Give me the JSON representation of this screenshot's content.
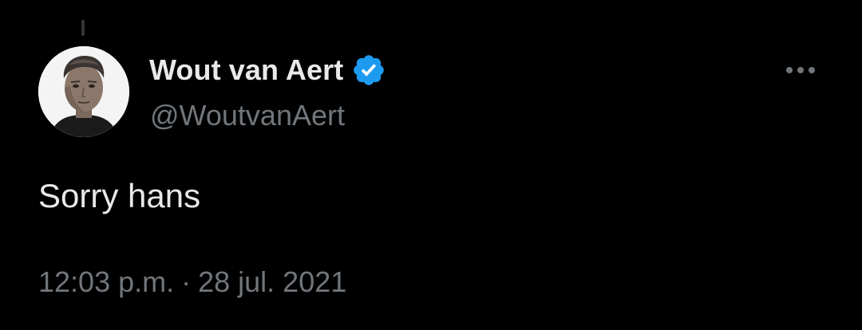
{
  "author": {
    "display_name": "Wout van Aert",
    "handle": "@WoutvanAert",
    "verified": true
  },
  "tweet": {
    "text": "Sorry hans",
    "time": "12:03 p.m.",
    "separator": "·",
    "date": "28 jul. 2021"
  },
  "icons": {
    "verified": "verified-badge-icon",
    "more": "more-horizontal-icon"
  },
  "colors": {
    "background": "#000000",
    "primary_text": "#e7e9ea",
    "secondary_text": "#71767b",
    "verified_blue": "#1d9bf0"
  }
}
